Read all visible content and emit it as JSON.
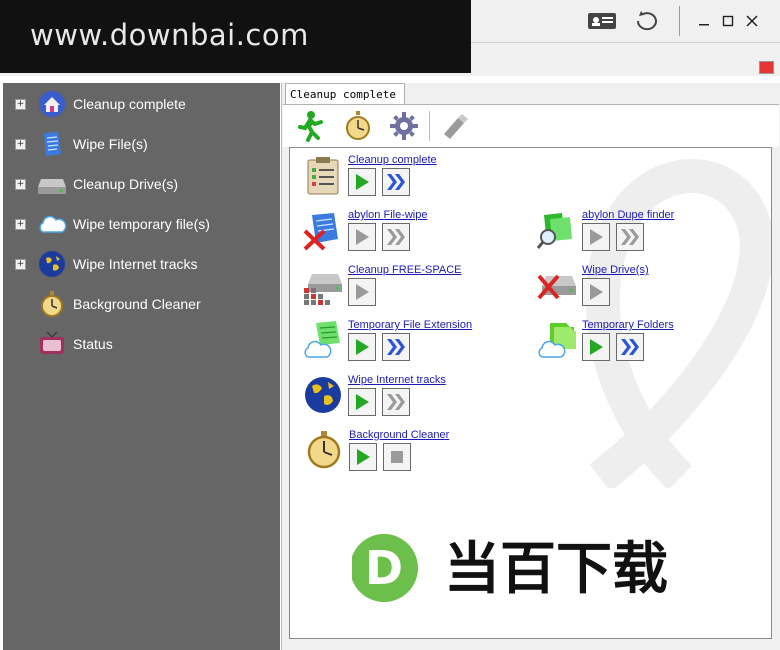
{
  "watermark": {
    "text": "www.downbai.com"
  },
  "titlebar": {
    "icons": [
      "contact-card-icon",
      "refresh-icon",
      "minimize-icon",
      "maximize-icon",
      "close-icon"
    ]
  },
  "sidebar": {
    "items": [
      {
        "label": "Cleanup complete",
        "icon": "house-icon",
        "expandable": true
      },
      {
        "label": "Wipe File(s)",
        "icon": "document-icon",
        "expandable": true
      },
      {
        "label": "Cleanup Drive(s)",
        "icon": "drive-icon",
        "expandable": true
      },
      {
        "label": "Wipe temporary file(s)",
        "icon": "cloud-icon",
        "expandable": true
      },
      {
        "label": "Wipe Internet tracks",
        "icon": "globe-icon",
        "expandable": true
      },
      {
        "label": "Background Cleaner",
        "icon": "stopwatch-icon",
        "expandable": false
      },
      {
        "label": "Status",
        "icon": "monitor-icon",
        "expandable": false
      }
    ]
  },
  "tab": {
    "label": "Cleanup complete"
  },
  "toolbar": {
    "icons": [
      "running-man-icon",
      "stopwatch-icon",
      "gear-icon",
      "usb-stick-icon"
    ]
  },
  "tasks": [
    {
      "label": "Cleanup complete",
      "icon": "clipboard-icon",
      "play_enabled": true,
      "second": "double-arrow",
      "second_enabled": true
    },
    {
      "label": "abylon File-wipe",
      "icon": "file-wipe-icon",
      "play_enabled": false,
      "second": "double-arrow",
      "second_enabled": false
    },
    {
      "label": "abylon Dupe finder",
      "icon": "dupe-finder-icon",
      "play_enabled": false,
      "second": "double-arrow",
      "second_enabled": false
    },
    {
      "label": "Cleanup FREE-SPACE",
      "icon": "free-space-icon",
      "play_enabled": false,
      "second": "none",
      "second_enabled": false
    },
    {
      "label": "Wipe Drive(s)",
      "icon": "wipe-drive-icon",
      "play_enabled": false,
      "second": "none",
      "second_enabled": false
    },
    {
      "label": "Temporary File Extension",
      "icon": "temp-extension-icon",
      "play_enabled": true,
      "second": "double-arrow",
      "second_enabled": true
    },
    {
      "label": "Temporary Folders",
      "icon": "temp-folders-icon",
      "play_enabled": true,
      "second": "double-arrow",
      "second_enabled": true
    },
    {
      "label": "Wipe Internet tracks",
      "icon": "globe-icon",
      "play_enabled": true,
      "second": "double-arrow",
      "second_enabled": false
    },
    {
      "label": "Background Cleaner",
      "icon": "stopwatch-icon",
      "play_enabled": true,
      "second": "stop",
      "second_enabled": false
    }
  ],
  "brand_watermark": {
    "letter": "D",
    "text": "当百下载"
  },
  "colors": {
    "sidebar_bg": "#666666",
    "link": "#1b1bb3",
    "play_green": "#23a823",
    "double_arrow_blue": "#2a55d6",
    "disabled_gray": "#9a9a9a",
    "brand_green": "#6cbf4a"
  }
}
